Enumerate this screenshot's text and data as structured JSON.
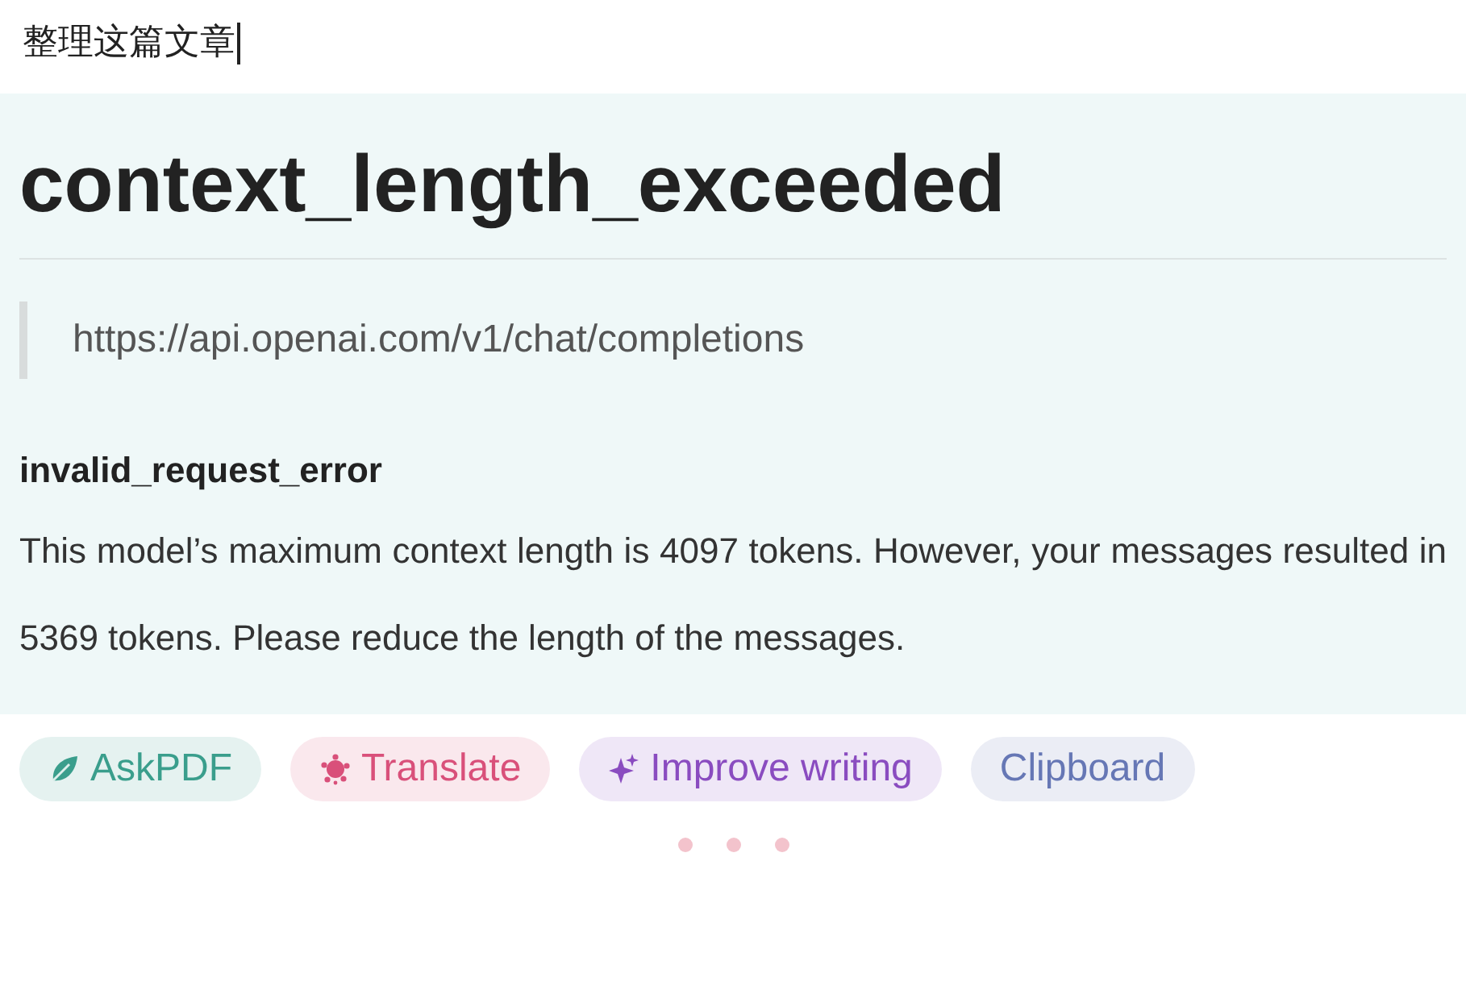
{
  "prompt": {
    "value": "整理这篇文章"
  },
  "response": {
    "title": "context_length_exceeded",
    "endpoint": "https://api.openai.com/v1/chat/completions",
    "error_type": "invalid_request_error",
    "message": "This model’s maximum context length is 4097 tokens. However, your messages resulted in 5369 tokens. Please reduce the length of the messages."
  },
  "actions": [
    {
      "label": "AskPDF",
      "kind": "icon",
      "color": "#3a9e8c"
    },
    {
      "label": "Translate",
      "kind": "icon",
      "color": "#d9507a"
    },
    {
      "label": "Improve writing",
      "kind": "icon",
      "color": "#8a4cc0"
    },
    {
      "label": "Clipboard",
      "kind": "text",
      "color": "#6677b5"
    }
  ]
}
